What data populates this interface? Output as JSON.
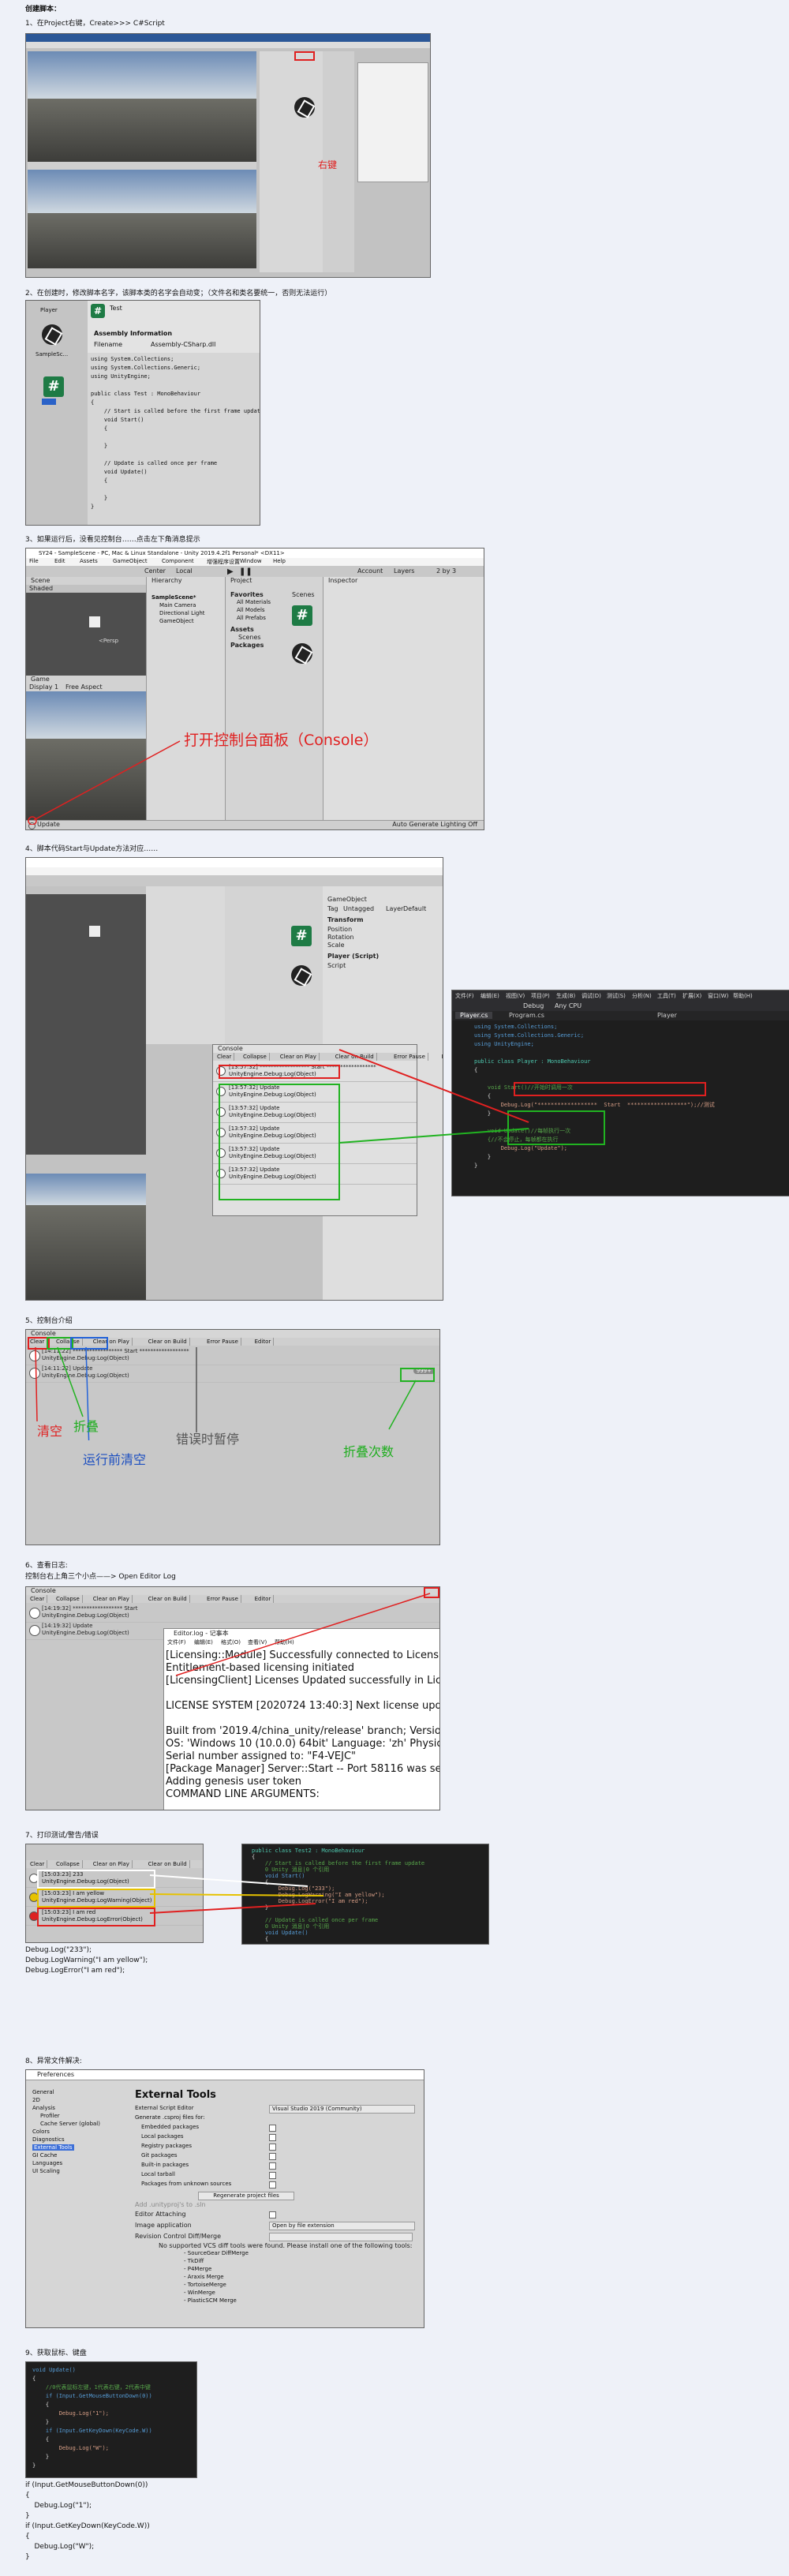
{
  "doc_title": "创建脚本：",
  "s1": {
    "heading": "1、在Project右键，Create>>> C#Script",
    "annot": "右键"
  },
  "s2": {
    "heading": "2、在创建时，修改脚本名字，该脚本类的名字会自动变；（文件名和类名要统一，否则无法运行）",
    "inspector_title": "Test",
    "assembly_label": "Assembly Information",
    "filename_label": "Filename",
    "filename_value": "Assembly-CSharp.dll",
    "asset_label1": "Player",
    "asset_label2": "SampleSc...",
    "asset_label3": "Test",
    "code": [
      "using System.Collections;",
      "using System.Collections.Generic;",
      "using UnityEngine;",
      "",
      "public class Test : MonoBehaviour",
      "{",
      "    // Start is called before the first frame update",
      "    void Start()",
      "    {",
      "",
      "    }",
      "",
      "    // Update is called once per frame",
      "    void Update()",
      "    {",
      "",
      "    }",
      "}"
    ]
  },
  "s3": {
    "heading": "3、如果运行后，没看见控制台……点击左下角消息提示",
    "title": "SY24 - SampleScene - PC, Mac & Linux Standalone - Unity 2019.4.2f1 Personal* <DX11>",
    "menu": [
      "File",
      "Edit",
      "Assets",
      "GameObject",
      "Component",
      "增强程序设置",
      "Window",
      "Help"
    ],
    "center_btn": "Center",
    "local_btn": "Local",
    "account": "Account",
    "layers": "Layers",
    "layout": "2 by 3",
    "scene_tab": "Scene",
    "game_tab": "Game",
    "shaded": "Shaded",
    "hierarchy_tab": "Hierarchy",
    "project_tab": "Project",
    "inspector_tab": "Inspector",
    "hier_items": [
      "SampleScene*",
      "Main Camera",
      "Directional Light",
      "GameObject"
    ],
    "favorites": "Favorites",
    "fav_items": [
      "All Materials",
      "All Models",
      "All Prefabs"
    ],
    "assets_label": "Assets",
    "assets_sub": [
      "Scenes"
    ],
    "packages": "Packages",
    "scenes_label": "Scenes",
    "display": "Display 1",
    "aspect": "Free Aspect",
    "persp": "<Persp",
    "status": "Update",
    "status_right": "Auto Generate Lighting Off",
    "annot": "打开控制台面板（Console）"
  },
  "s4": {
    "heading": "4、脚本代码Start与Update方法对应……",
    "console_tab": "Console",
    "console_btns": [
      "Clear",
      "Collapse",
      "Clear on Play",
      "Clear on Build",
      "Error Pause",
      "Editor"
    ],
    "logs": [
      {
        "l1": "[13:57:32] ****************** Start ******************",
        "l2": "UnityEngine.Debug:Log(Object)"
      },
      {
        "l1": "[13:57:32] Update",
        "l2": "UnityEngine.Debug:Log(Object)"
      },
      {
        "l1": "[13:57:32] Update",
        "l2": "UnityEngine.Debug:Log(Object)"
      },
      {
        "l1": "[13:57:32] Update",
        "l2": "UnityEngine.Debug:Log(Object)"
      },
      {
        "l1": "[13:57:32] Update",
        "l2": "UnityEngine.Debug:Log(Object)"
      },
      {
        "l1": "[13:57:32] Update",
        "l2": "UnityEngine.Debug:Log(Object)"
      }
    ],
    "inspector_obj": "GameObject",
    "tag_label": "Tag",
    "tag_value": "Untagged",
    "layer_label": "Layer",
    "layer_value": "Default",
    "transform": "Transform",
    "position": "Position",
    "rotation": "Rotation",
    "scale": "Scale",
    "player_script": "Player (Script)",
    "script_label": "Script",
    "vs_menu": [
      "文件(F)",
      "编辑(E)",
      "视图(V)",
      "项目(P)",
      "生成(B)",
      "调试(D)",
      "测试(S)",
      "分析(N)",
      "工具(T)",
      "扩展(X)",
      "窗口(W)",
      "帮助(H)"
    ],
    "vs_tab1": "Player.cs",
    "vs_tab2": "Program.cs",
    "vs_debug": "Debug",
    "vs_cpu": "Any CPU",
    "vs_class": "Player",
    "vs_code": [
      {
        "c": "kw",
        "t": "using System.Collections;"
      },
      {
        "c": "kw",
        "t": "using System.Collections.Generic;"
      },
      {
        "c": "kw",
        "t": "using UnityEngine;"
      },
      {
        "c": "pl",
        "t": ""
      },
      {
        "c": "ty",
        "t": "public class Player : MonoBehaviour"
      },
      {
        "c": "pl",
        "t": "{"
      },
      {
        "c": "pl",
        "t": ""
      },
      {
        "c": "cm",
        "t": "    void Start()//开始时调用一次"
      },
      {
        "c": "pl",
        "t": "    {"
      },
      {
        "c": "st",
        "t": "        Debug.Log(\"******************  Start  ******************\");//测试"
      },
      {
        "c": "pl",
        "t": "    }"
      },
      {
        "c": "pl",
        "t": ""
      },
      {
        "c": "cm",
        "t": "    void Update()//每帧执行一次"
      },
      {
        "c": "cm",
        "t": "    {//不会停止，每帧都在执行"
      },
      {
        "c": "st",
        "t": "        Debug.Log(\"Update\");"
      },
      {
        "c": "pl",
        "t": "    }"
      },
      {
        "c": "pl",
        "t": "}"
      }
    ]
  },
  "s5": {
    "heading": "5、控制台介绍",
    "console_tab": "Console",
    "btns": [
      "Clear",
      "Collapse",
      "Clear on Play",
      "Clear on Build",
      "Error Pause",
      "Editor"
    ],
    "row1a": "[14:11:22] ****************** Start ******************",
    "row1b": "UnityEngine.Debug:Log(Object)",
    "row2a": "[14:11:22] Update",
    "row2b": "UnityEngine.Debug:Log(Object)",
    "count": "999+",
    "labels": {
      "clear": "清空",
      "collapse": "折叠",
      "clear_on_play": "运行前清空",
      "error_pause": "错误时暂停",
      "count": "折叠次数"
    }
  },
  "s6": {
    "heading": "6、查看日志:",
    "sub": "控制台右上角三个小点——> Open Editor Log",
    "console_tab": "Console",
    "btns": [
      "Clear",
      "Collapse",
      "Clear on Play",
      "Clear on Build",
      "Error Pause",
      "Editor"
    ],
    "row1a": "[14:19:32] ****************** Start",
    "row1b": "UnityEngine.Debug:Log(Object)",
    "row2a": "[14:19:32] Update",
    "row2b": "UnityEngine.Debug:Log(Object)",
    "log_title": "Editor.log - 记事本",
    "log_menu": [
      "文件(F)",
      "编辑(E)",
      "格式(O)",
      "查看(V)",
      "帮助(H)"
    ],
    "log_lines": [
      "[Licensing::Module] Successfully connected to LicensingClient",
      "Entitlement-based licensing initiated",
      "[LicensingClient] Licenses Updated successfully in LicensingClient",
      "",
      "LICENSE SYSTEM [2020724 13:40:3] Next license update check",
      "",
      "Built from '2019.4/china_unity/release' branch; Version is",
      "OS: 'Windows 10  (10.0.0) 64bit' Language: 'zh' Physical",
      "Serial number assigned to: \"F4-VEJC\"",
      "[Package Manager] Server::Start -- Port 58116 was selected",
      "Adding genesis user token",
      "COMMAND LINE ARGUMENTS:"
    ]
  },
  "s7": {
    "heading": "7、打印测试/警告/错误",
    "btns": [
      "Clear",
      "Collapse",
      "Clear on Play",
      "Clear on Build",
      "Error Pause"
    ],
    "rows": [
      {
        "a": "[15:03:23] 233",
        "b": "UnityEngine.Debug:Log(Object)"
      },
      {
        "a": "[15:03:23] I am yellow",
        "b": "UnityEngine.Debug:LogWarning(Object)"
      },
      {
        "a": "[15:03:23] I am red",
        "b": "UnityEngine.Debug:LogError(Object)"
      }
    ],
    "vs_code": [
      {
        "c": "ty",
        "t": "public class Test2 : MonoBehaviour"
      },
      {
        "c": "pl",
        "t": "{"
      },
      {
        "c": "cm",
        "t": "    // Start is called before the first frame update"
      },
      {
        "c": "cm",
        "t": "    0 Unity 消息|0 个引用"
      },
      {
        "c": "kw",
        "t": "    void Start()"
      },
      {
        "c": "pl",
        "t": "    {"
      },
      {
        "c": "st",
        "t": "        Debug.Log(\"233\");"
      },
      {
        "c": "st",
        "t": "        Debug.LogWarning(\"I am yellow\");"
      },
      {
        "c": "st",
        "t": "        Debug.LogError(\"I am red\");"
      },
      {
        "c": "pl",
        "t": "    }"
      },
      {
        "c": "pl",
        "t": ""
      },
      {
        "c": "cm",
        "t": "    // Update is called once per frame"
      },
      {
        "c": "cm",
        "t": "    0 Unity 消息|0 个引用"
      },
      {
        "c": "kw",
        "t": "    void Update()"
      },
      {
        "c": "pl",
        "t": "    {"
      }
    ],
    "after": [
      "Debug.Log(\"233\");",
      "Debug.LogWarning(\"I am yellow\");",
      "Debug.LogError(\"I am red\");"
    ]
  },
  "s8": {
    "heading": "8、异常文件解决:",
    "window_title": "Preferences",
    "left_items": [
      "General",
      "2D",
      "Analysis",
      "Profiler",
      "Cache Server (global)",
      "Colors",
      "Diagnostics",
      "External Tools",
      "GI Cache",
      "Languages",
      "UI Scaling"
    ],
    "selected": "External Tools",
    "panel_title": "External Tools",
    "rows": [
      {
        "k": "External Script Editor",
        "v": "Visual Studio 2019 (Community)"
      },
      {
        "k": "Generate .csproj files for:",
        "v": ""
      },
      {
        "k": "Embedded packages",
        "v": ""
      },
      {
        "k": "Local packages",
        "v": ""
      },
      {
        "k": "Registry packages",
        "v": ""
      },
      {
        "k": "Git packages",
        "v": ""
      },
      {
        "k": "Built-in packages",
        "v": ""
      },
      {
        "k": "Local tarball",
        "v": ""
      },
      {
        "k": "Packages from unknown sources",
        "v": ""
      }
    ],
    "regen": "Regenerate project files",
    "add_unity": "Add .unityproj's to .sln",
    "editor_attaching": "Editor Attaching",
    "image_app": "Image application",
    "image_app_v": "Open by file extension",
    "revision": "Revision Control Diff/Merge",
    "note": "No supported VCS diff tools were found. Please install one of the following tools:",
    "tools": [
      "- SourceGear DiffMerge",
      "- TkDiff",
      "- P4Merge",
      "- Araxis Merge",
      "- TortoiseMerge",
      "- WinMerge",
      "- PlasticSCM Merge"
    ]
  },
  "s9": {
    "heading": "9、获取鼠标、键盘",
    "code": [
      {
        "c": "kw",
        "t": "void Update()"
      },
      {
        "c": "pl",
        "t": "{"
      },
      {
        "c": "cm",
        "t": "    //0代表鼠标左键，1代表右键，2代表中键"
      },
      {
        "c": "kw",
        "t": "    if (Input.GetMouseButtonDown(0))"
      },
      {
        "c": "pl",
        "t": "    {"
      },
      {
        "c": "st",
        "t": "        Debug.Log(\"1\");"
      },
      {
        "c": "pl",
        "t": "    }"
      },
      {
        "c": "kw",
        "t": "    if (Input.GetKeyDown(KeyCode.W))"
      },
      {
        "c": "pl",
        "t": "    {"
      },
      {
        "c": "st",
        "t": "        Debug.Log(\"W\");"
      },
      {
        "c": "pl",
        "t": "    }"
      },
      {
        "c": "pl",
        "t": "}"
      }
    ],
    "after": [
      "if (Input.GetMouseButtonDown(0))",
      "{",
      "    Debug.Log(\"1\");",
      "}",
      "if (Input.GetKeyDown(KeyCode.W))",
      "{",
      "    Debug.Log(\"W\");",
      "}"
    ]
  }
}
